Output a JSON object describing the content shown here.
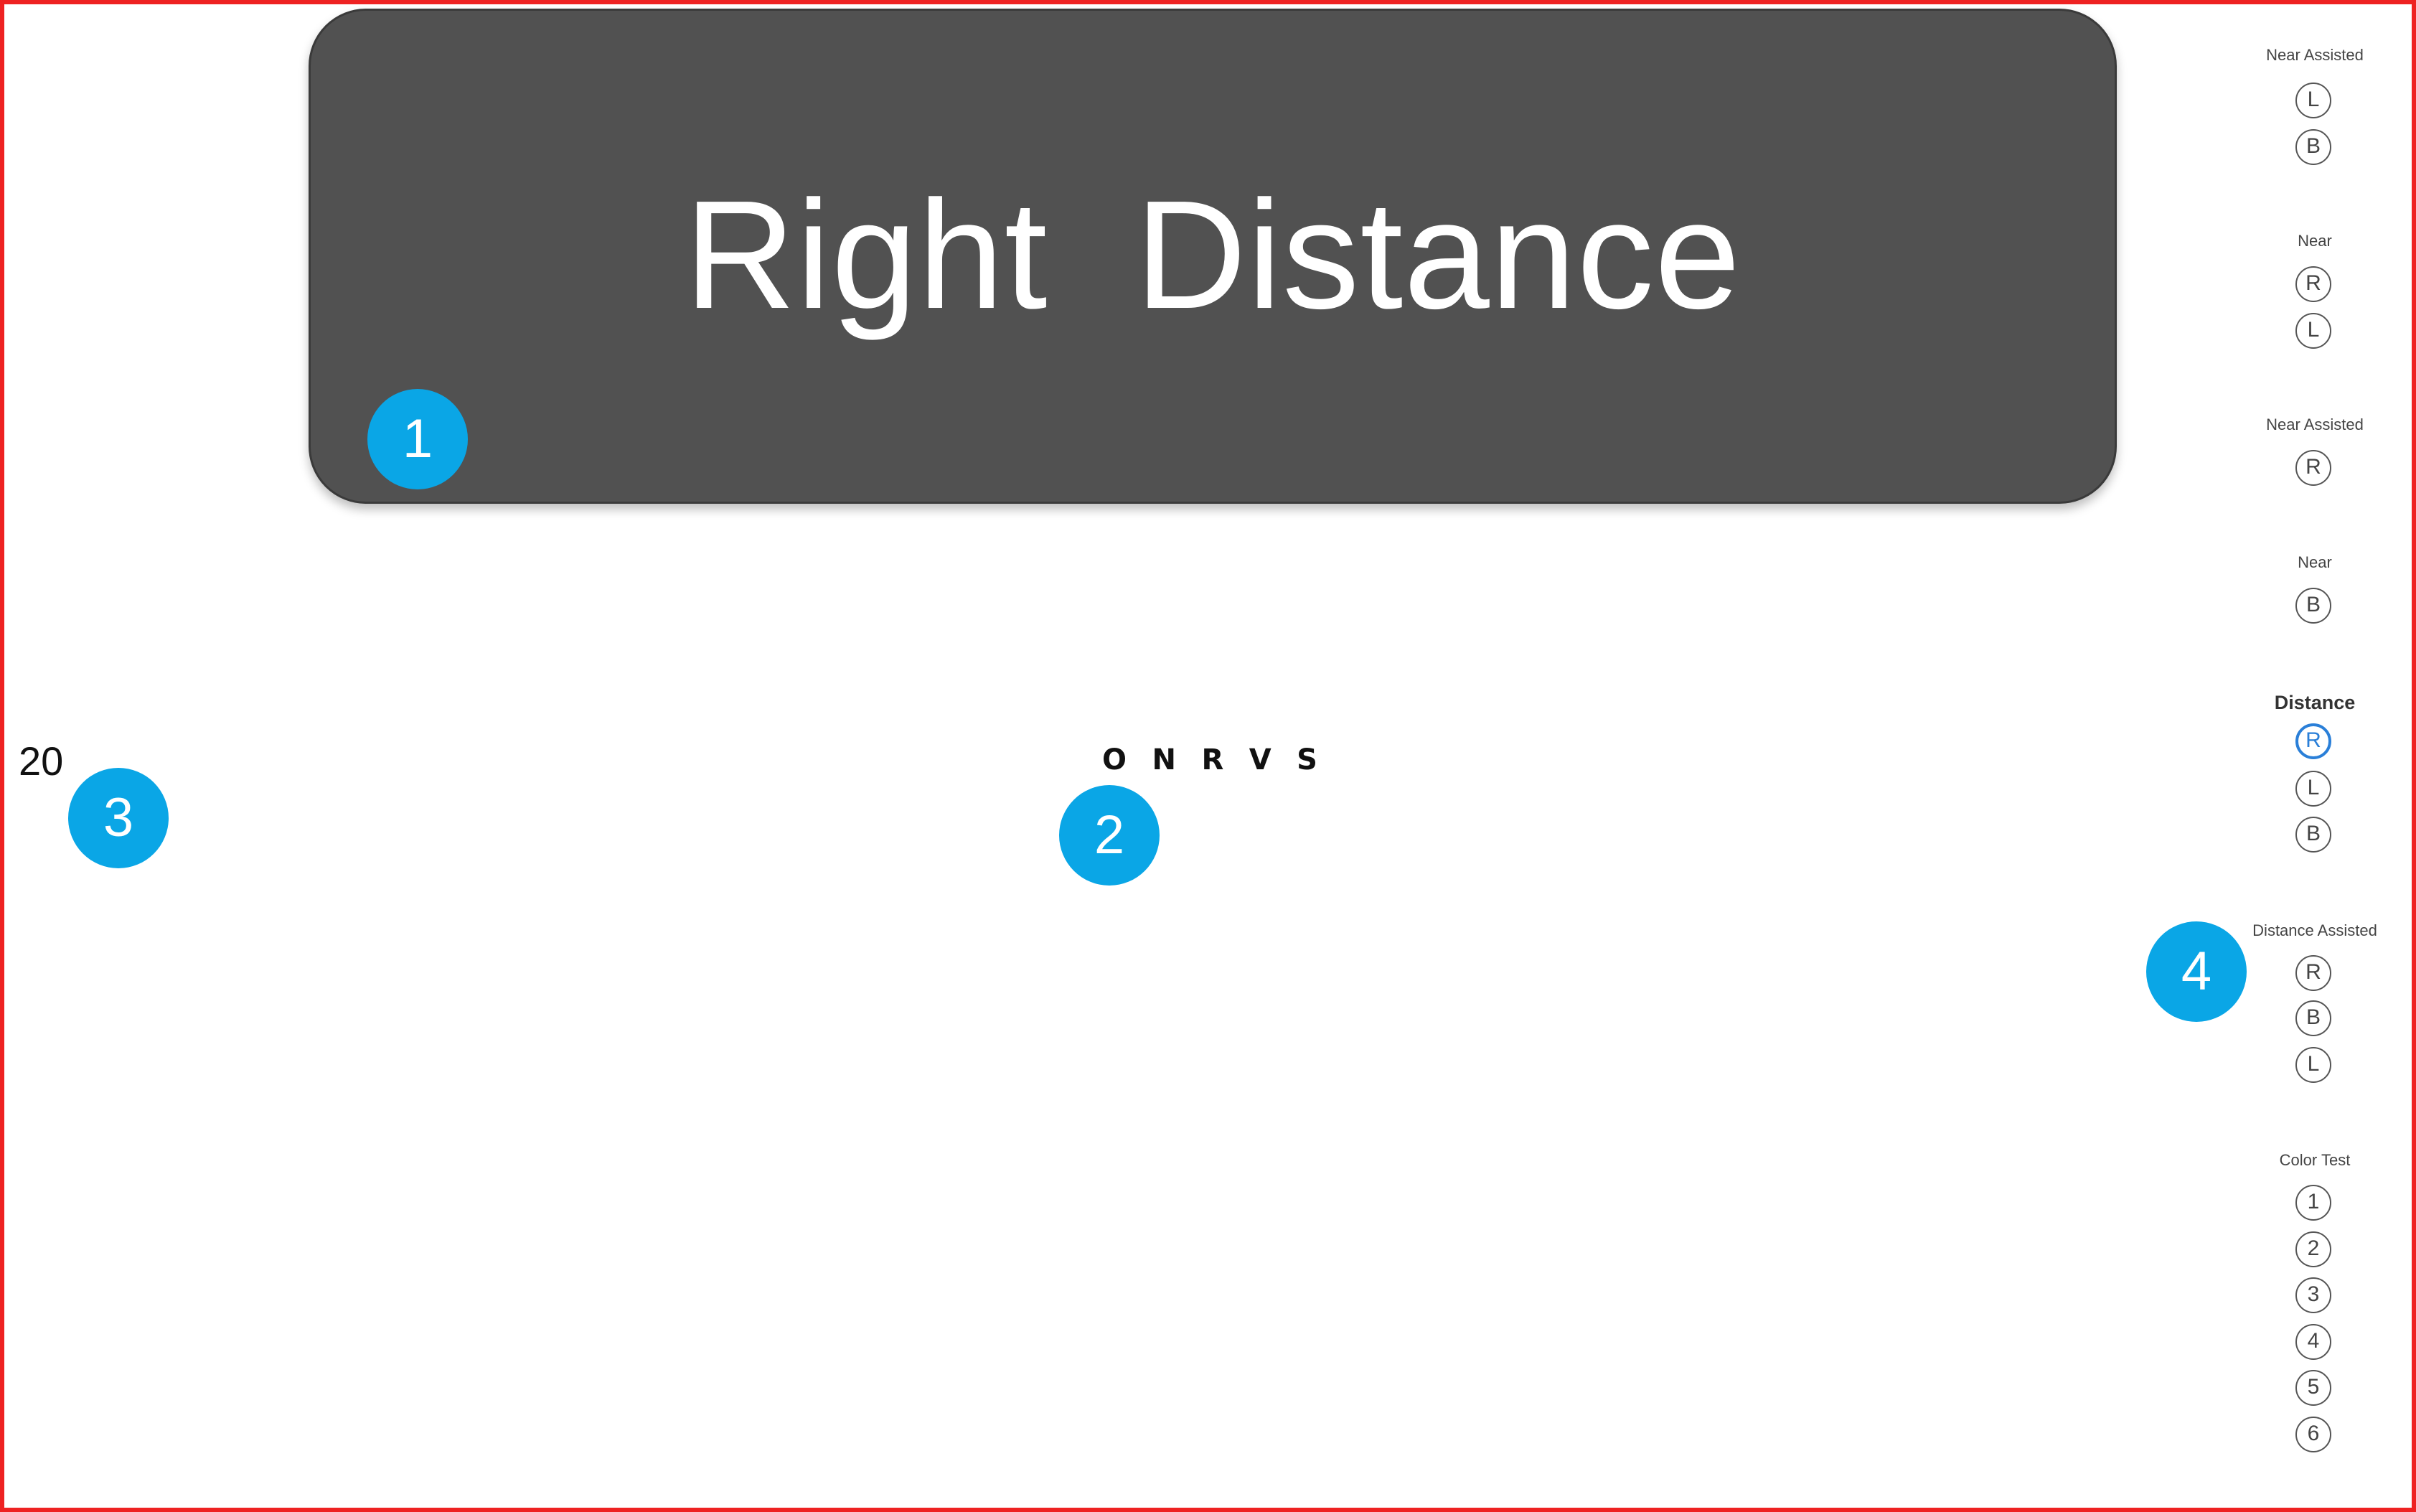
{
  "banner": {
    "title": "Right  Distance"
  },
  "chart": {
    "letters": [
      "O",
      "N",
      "R",
      "V",
      "S"
    ]
  },
  "acuity": {
    "value": "20"
  },
  "badges": [
    "1",
    "2",
    "3",
    "4"
  ],
  "colors": {
    "badge": "#0aa6e6",
    "banner": "#515151",
    "active": "#2a7fd8",
    "frame": "#ee2222"
  },
  "sidebar": {
    "groups": [
      {
        "label": "Near Assisted",
        "options": [
          "L",
          "B"
        ]
      },
      {
        "label": "Near",
        "options": [
          "R",
          "L"
        ]
      },
      {
        "label": "Near Assisted",
        "options": [
          "R"
        ]
      },
      {
        "label": "Near",
        "options": [
          "B"
        ]
      },
      {
        "label": "Distance",
        "options": [
          "R",
          "L",
          "B"
        ],
        "active": true,
        "selected": "R"
      },
      {
        "label": "Distance Assisted",
        "options": [
          "R",
          "B",
          "L"
        ]
      },
      {
        "label": "Color Test",
        "options": [
          "1",
          "2",
          "3",
          "4",
          "5",
          "6"
        ]
      }
    ]
  }
}
